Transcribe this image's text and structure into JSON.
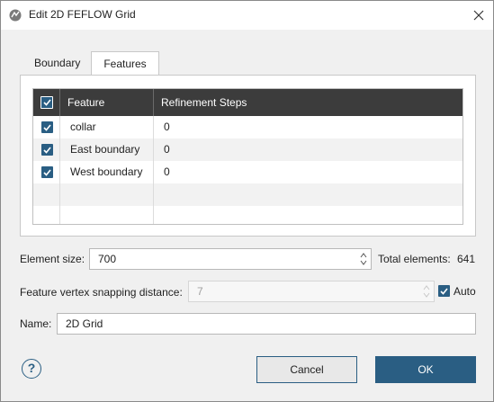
{
  "window": {
    "title": "Edit 2D FEFLOW Grid"
  },
  "tabs": [
    {
      "label": "Boundary",
      "selected": false
    },
    {
      "label": "Features",
      "selected": true
    }
  ],
  "grid": {
    "columns": [
      "Feature",
      "Refinement Steps"
    ],
    "header_checked": true,
    "rows": [
      {
        "checked": true,
        "feature": "collar",
        "steps": "0"
      },
      {
        "checked": true,
        "feature": "East boundary",
        "steps": "0"
      },
      {
        "checked": true,
        "feature": "West boundary",
        "steps": "0"
      }
    ]
  },
  "form": {
    "element_size_label": "Element size:",
    "element_size_value": "700",
    "total_elements_label": "Total elements:",
    "total_elements_value": "641",
    "snap_label": "Feature vertex snapping distance:",
    "snap_value": "7",
    "auto_label": "Auto",
    "auto_checked": true,
    "name_label": "Name:",
    "name_value": "2D Grid"
  },
  "buttons": {
    "help": "?",
    "cancel": "Cancel",
    "ok": "OK"
  },
  "colors": {
    "accent": "#2a5e83",
    "header_bg": "#3c3c3c",
    "dialog_bg": "#f0f0f0"
  },
  "icons": {
    "app": "app-icon",
    "close": "close-icon",
    "check": "checkmark-icon",
    "spinner": "spinner-arrows-icon",
    "help": "help-icon"
  }
}
